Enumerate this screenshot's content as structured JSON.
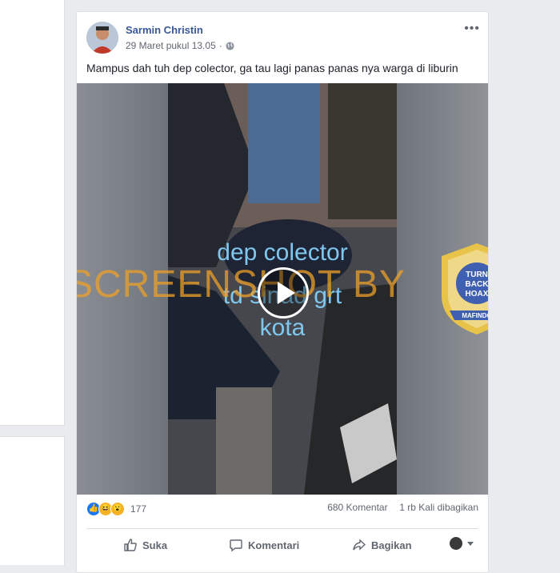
{
  "post": {
    "author": "Sarmin Christin",
    "timestamp": "29 Maret pukul 13.05",
    "separator": "·",
    "privacy_icon": "globe-icon",
    "more_label": "•••",
    "text": "Mampus dah tuh dep colector, ga tau lagi panas panas nya warga di liburin"
  },
  "video": {
    "overlay_lines": [
      "dep colector",
      "td sinad grt",
      "kota"
    ],
    "watermark": "SCREENSHOT BY",
    "badge": {
      "arc_text": "MASYARAKAT ANTI FITNAH INDONESIA",
      "center_lines": [
        "TURN",
        "BACK",
        "HOAX"
      ],
      "ribbon": "MAFINDO"
    }
  },
  "stats": {
    "reaction_icons": [
      "like-icon",
      "haha-icon",
      "wow-icon"
    ],
    "reaction_count": "177",
    "comments": "680 Komentar",
    "shares": "1 rb Kali dibagikan"
  },
  "actions": {
    "like": "Suka",
    "comment": "Komentari",
    "share": "Bagikan"
  },
  "colors": {
    "facebook_blue": "#385898",
    "background": "#e9ebee",
    "watermark": "#eea028",
    "overlay_text": "#7fc7ef"
  }
}
